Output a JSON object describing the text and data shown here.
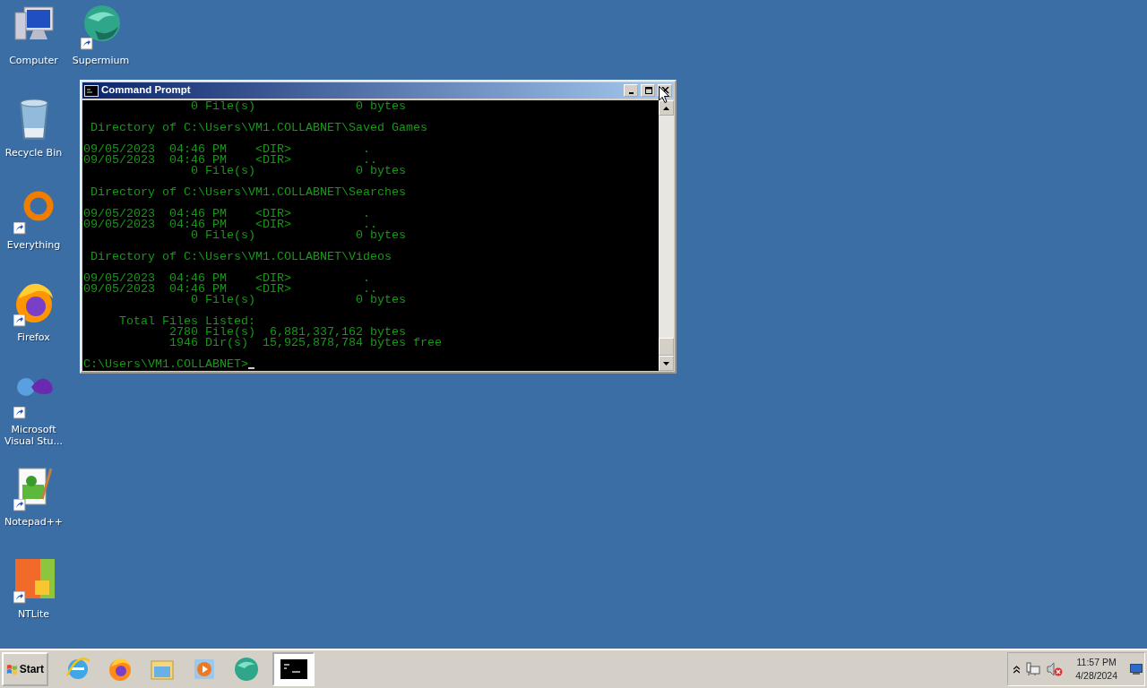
{
  "desktop_icons": [
    {
      "label": "Computer",
      "kind": "computer",
      "shortcut": false
    },
    {
      "label": "Recycle Bin",
      "kind": "recycle",
      "shortcut": false
    },
    {
      "label": "Everything",
      "kind": "ring",
      "shortcut": true
    },
    {
      "label": "Firefox",
      "kind": "firefox",
      "shortcut": true
    },
    {
      "label": "Microsoft Visual Stu...",
      "kind": "loop",
      "shortcut": true
    },
    {
      "label": "Notepad++",
      "kind": "notepad",
      "shortcut": true
    },
    {
      "label": "NTLite",
      "kind": "tiles",
      "shortcut": true
    },
    {
      "label": "Supermium",
      "kind": "sphere",
      "shortcut": true
    }
  ],
  "window": {
    "title": "Command Prompt",
    "console_blocks": [
      [
        "               0 File(s)              0 bytes"
      ],
      [
        " Directory of C:\\Users\\VM1.COLLABNET\\Saved Games"
      ],
      [
        "09/05/2023  04:46 PM    <DIR>          .",
        "09/05/2023  04:46 PM    <DIR>          ..",
        "               0 File(s)              0 bytes"
      ],
      [
        " Directory of C:\\Users\\VM1.COLLABNET\\Searches"
      ],
      [
        "09/05/2023  04:46 PM    <DIR>          .",
        "09/05/2023  04:46 PM    <DIR>          ..",
        "               0 File(s)              0 bytes"
      ],
      [
        " Directory of C:\\Users\\VM1.COLLABNET\\Videos"
      ],
      [
        "09/05/2023  04:46 PM    <DIR>          .",
        "09/05/2023  04:46 PM    <DIR>          ..",
        "               0 File(s)              0 bytes"
      ],
      [
        "     Total Files Listed:",
        "            2780 File(s)  6,881,337,162 bytes",
        "            1946 Dir(s)  15,925,878,784 bytes free"
      ]
    ],
    "prompt": "C:\\Users\\VM1.COLLABNET>"
  },
  "taskbar": {
    "start": "Start",
    "quick_launch": [
      {
        "kind": "ie"
      },
      {
        "kind": "firefox"
      },
      {
        "kind": "folder"
      },
      {
        "kind": "media"
      },
      {
        "kind": "sphere"
      }
    ],
    "tasks": [
      {
        "kind": "console",
        "selected": true
      }
    ],
    "tray": {
      "volume_muted": true,
      "time": "11:57 PM",
      "date": "4/28/2024"
    }
  }
}
